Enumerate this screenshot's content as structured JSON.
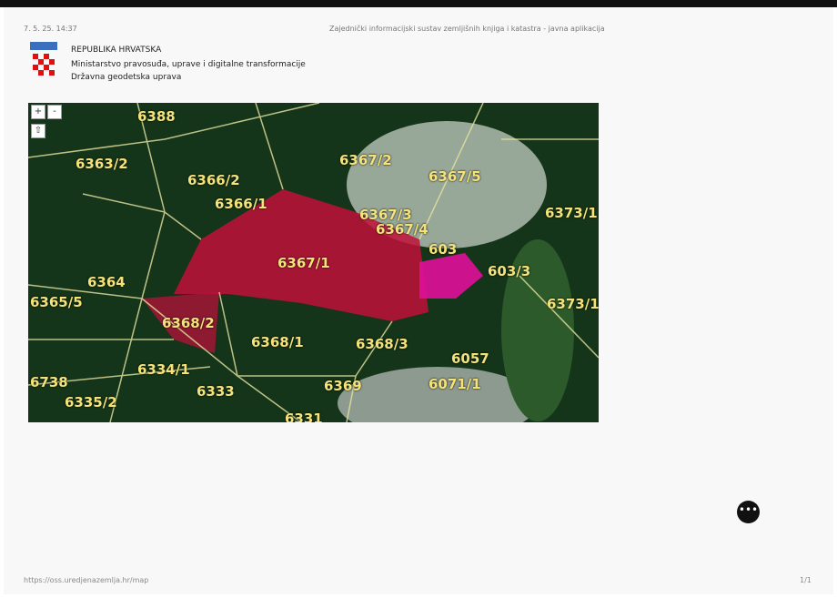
{
  "header": {
    "datetime": "7. 5. 25. 14:37",
    "app_title": "Zajednički informacijski sustav zemljišnih knjiga i katastra - javna aplikacija"
  },
  "org": {
    "line1": "REPUBLIKA HRVATSKA",
    "line2": "Ministarstvo pravosuđa, uprave i digitalne transformacije",
    "line3": "Državna geodetska uprava"
  },
  "map": {
    "zoom_in": "+",
    "zoom_out": "-",
    "home": "⇧",
    "parcels": [
      "6388",
      "6363/2",
      "6366/2",
      "6366/1",
      "6367/2",
      "6367/5",
      "6367/3",
      "6367/4",
      "6373/1",
      "6367/1",
      "6364",
      "603",
      "603/3",
      "6365/5",
      "6368/2",
      "6373/1",
      "6368/1",
      "6368/3",
      "6334/1",
      "6057",
      "6738",
      "6333",
      "6369",
      "6071/1",
      "6335/2",
      "6331"
    ],
    "highlight_color": "#e0105a"
  },
  "footer": {
    "url": "https://oss.uredjenazemlja.hr/map",
    "page": "1/1"
  }
}
